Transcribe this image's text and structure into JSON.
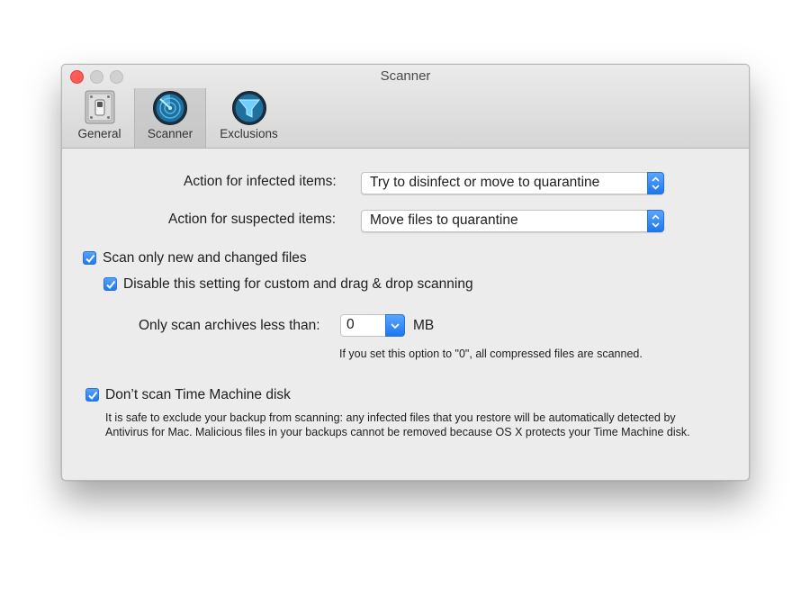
{
  "window": {
    "title": "Scanner"
  },
  "tabs": [
    {
      "label": "General",
      "icon": "switch-icon"
    },
    {
      "label": "Scanner",
      "icon": "radar-icon",
      "selected": true
    },
    {
      "label": "Exclusions",
      "icon": "funnel-icon"
    }
  ],
  "infected": {
    "label": "Action for infected items:",
    "value": "Try to disinfect or move to quarantine"
  },
  "suspected": {
    "label": "Action for suspected items:",
    "value": "Move files to quarantine"
  },
  "scan_new": {
    "label": "Scan only new and changed files",
    "checked": true
  },
  "disable_custom": {
    "label": "Disable this setting for custom and drag & drop scanning",
    "checked": true
  },
  "archives": {
    "label": "Only scan archives less than:",
    "value": "0",
    "unit": "MB",
    "hint": "If you set this option to \"0\", all compressed files are scanned."
  },
  "time_machine": {
    "label": "Don’t scan Time Machine disk",
    "checked": true,
    "note_line1": "It is safe to exclude your backup from scanning: any infected files that you restore will be automatically detected by",
    "note_line2": "Antivirus for Mac. Malicious files in your backups cannot be removed because OS X protects your Time Machine disk."
  },
  "colors": {
    "accent": "#1d79f0",
    "close": "#fc5b57"
  }
}
